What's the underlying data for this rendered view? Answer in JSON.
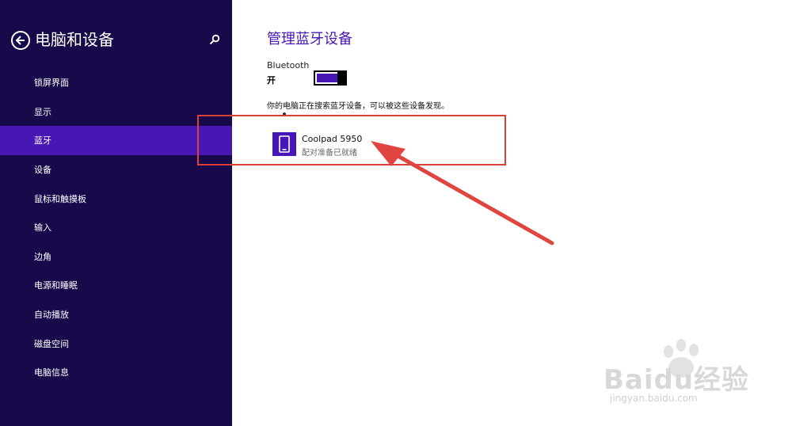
{
  "sidebar": {
    "title": "电脑和设备",
    "back_icon": "back-arrow-icon",
    "search_icon": "search-icon",
    "items": [
      {
        "label": "锁屏界面"
      },
      {
        "label": "显示"
      },
      {
        "label": "蓝牙",
        "active": true
      },
      {
        "label": "设备"
      },
      {
        "label": "鼠标和触摸板"
      },
      {
        "label": "输入"
      },
      {
        "label": "边角"
      },
      {
        "label": "电源和睡眠"
      },
      {
        "label": "自动播放"
      },
      {
        "label": "磁盘空间"
      },
      {
        "label": "电脑信息"
      }
    ]
  },
  "main": {
    "title": "管理蓝牙设备",
    "bluetooth_label": "Bluetooth",
    "bluetooth_state": "开",
    "toggle_on": true,
    "description": "你的电脑正在搜索蓝牙设备，可以被这些设备发现。",
    "devices": [
      {
        "name": "Coolpad 5950",
        "status": "配对准备已就绪",
        "icon": "phone-icon"
      }
    ]
  },
  "watermark": {
    "brand": "Baidu经验",
    "url": "jingyan.baidu.com"
  },
  "colors": {
    "sidebar_bg": "#180a4a",
    "accent": "#4617b4",
    "highlight": "#d9403a"
  }
}
